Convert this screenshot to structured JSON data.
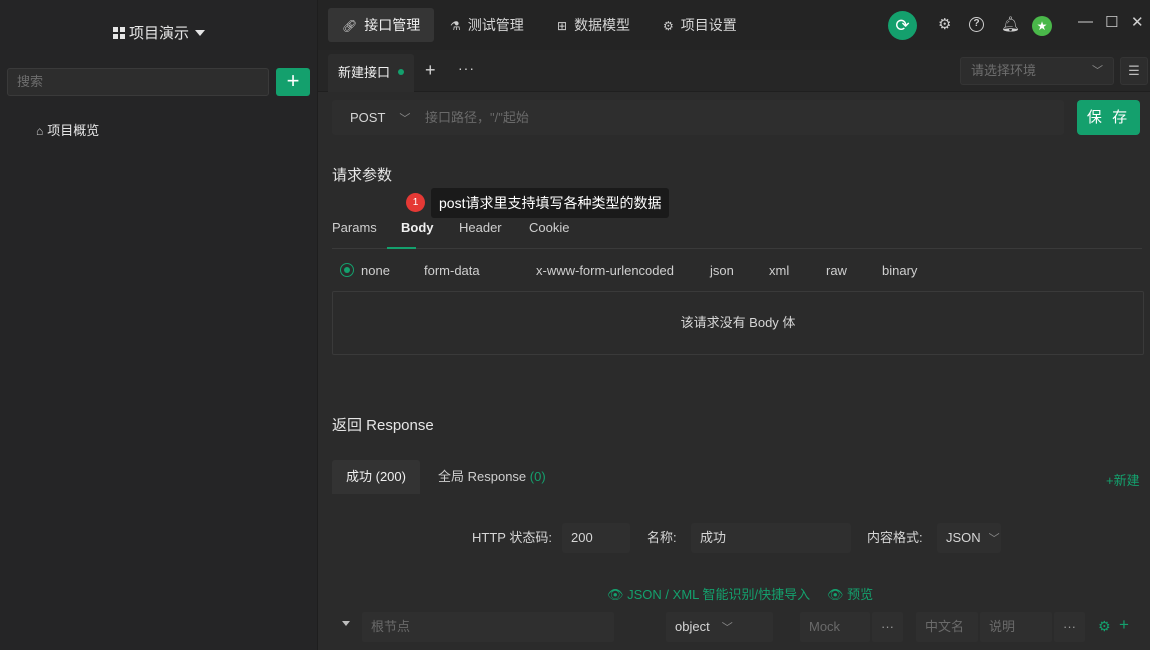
{
  "sidebar": {
    "project_name": "项目演示",
    "search_placeholder": "搜索",
    "add_label": "+",
    "items": [
      {
        "label": "项目概览",
        "icon": "bank-icon"
      }
    ]
  },
  "topbar": {
    "tabs": [
      {
        "label": "接口管理",
        "icon": "link-icon"
      },
      {
        "label": "测试管理",
        "icon": "flask-icon"
      },
      {
        "label": "数据模型",
        "icon": "model-icon"
      },
      {
        "label": "项目设置",
        "icon": "gear-icon"
      }
    ],
    "active_tab": 0
  },
  "doc_tabs": {
    "current": "新建接口",
    "add": "+",
    "more": "···",
    "env_placeholder": "请选择环境"
  },
  "request": {
    "method": "POST",
    "url_placeholder": "接口路径，\"/\"起始",
    "save_label": "保 存"
  },
  "params": {
    "section_title": "请求参数",
    "tabs": [
      "Params",
      "Body",
      "Header",
      "Cookie"
    ],
    "active_tab": "Body",
    "badge": "1",
    "tooltip": "post请求里支持填写各种类型的数据",
    "body_types": [
      "none",
      "form-data",
      "x-www-form-urlencoded",
      "json",
      "xml",
      "raw",
      "binary"
    ],
    "selected_body_type": "none",
    "empty_body_text": "该请求没有 Body 体"
  },
  "response": {
    "section_title": "返回 Response",
    "tabs": [
      {
        "label": "成功 (200)"
      },
      {
        "label": "全局 Response",
        "count": "(0)"
      }
    ],
    "new_label": "+新建",
    "status_label": "HTTP 状态码:",
    "status_value": "200",
    "name_label": "名称:",
    "name_value": "成功",
    "format_label": "内容格式:",
    "format_value": "JSON",
    "import_label": "JSON / XML 智能识别/快捷导入",
    "preview_label": "预览",
    "tree": {
      "root_placeholder": "根节点",
      "type": "object",
      "mock_placeholder": "Mock",
      "more": "···",
      "cn_name_placeholder": "中文名",
      "desc_placeholder": "说明",
      "more2": "···"
    }
  },
  "colors": {
    "accent": "#14a06d",
    "badge": "#e53935"
  }
}
